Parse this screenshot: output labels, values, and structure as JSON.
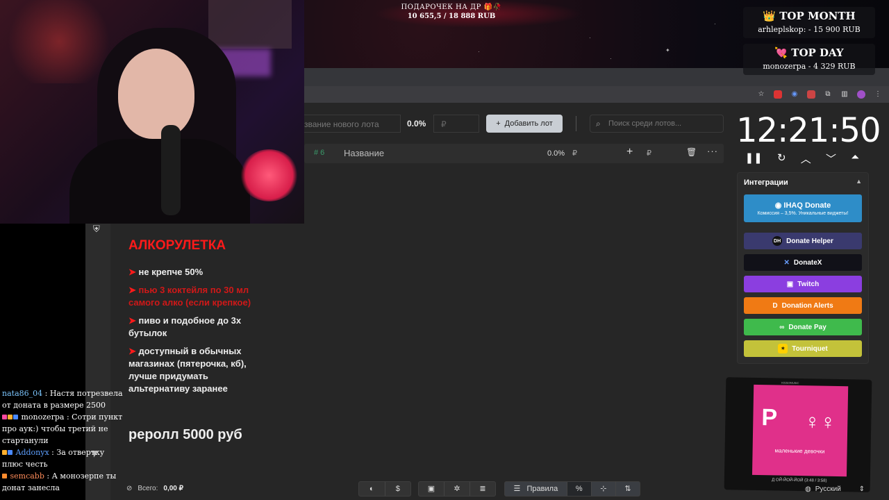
{
  "overlay": {
    "gift_title": "ПОДАРОЧЕК НА ДР 🎁🥀",
    "gift_value": "10 655,5 / 18 888 RUB",
    "top_month": {
      "title": "TOP MONTH",
      "entry": "arhleplskop: - 15 900 RUB",
      "icon": "👑"
    },
    "top_day": {
      "title": "TOP DAY",
      "entry": "monozerpa - 4 329 RUB",
      "icon": "💘"
    }
  },
  "toolbar": {
    "lot_name_placeholder": "Название нового лота",
    "lot_name_visible": "звание нового лота",
    "percent": "0.0%",
    "price_placeholder": "₽",
    "add_button": "Добавить лот",
    "search_placeholder": "Поиск среди лотов..."
  },
  "lots": [
    {
      "number": "# 6",
      "name": "Название",
      "percent": "0.0%",
      "currency": "₽",
      "add_currency": "₽"
    }
  ],
  "timer": {
    "time": "12:21:50"
  },
  "integrations": {
    "title": "Интеграции",
    "ihaq": {
      "label": "IHAQ Donate",
      "sub": "Комиссия – 3,5%. Уникальные виджеты!"
    },
    "buttons": [
      {
        "label": "Donate Helper",
        "color": "#3a3a6e",
        "icon": "DH"
      },
      {
        "label": "DonateX",
        "color": "#111118",
        "icon": "✕"
      },
      {
        "label": "Twitch",
        "color": "#8b3ee0",
        "icon": "▣"
      },
      {
        "label": "Donation Alerts",
        "color": "#f07a14",
        "icon": "D"
      },
      {
        "label": "Donate Pay",
        "color": "#3fba4c",
        "icon": "∞"
      },
      {
        "label": "Tourniquet",
        "color": "#c3c23a",
        "icon": "✶"
      }
    ]
  },
  "rules": {
    "title": "АЛКОРУЛЕТКА",
    "items": [
      {
        "text": "не крепче 50%",
        "red": false
      },
      {
        "text": "пью 3 коктейля по 30 мл самого алко (если крепкое)",
        "red": true
      },
      {
        "text": "пиво и подобное до 3х бутылок",
        "red": false
      },
      {
        "text": "доступный в обычных магазинах (пятерочка, кб), лучше придумать альтернативу заранее",
        "red": false
      }
    ],
    "reroll": "реролл 5000 руб"
  },
  "chat": [
    {
      "user": "nata86_04",
      "sep": ":",
      "text": "Настя потрезвела от доната в размере 2500",
      "color": "#7cc6ff"
    },
    {
      "user": "monozerpa",
      "sep": ":",
      "text": "Сотри пункт про аук:) чтобы третий не стартанули",
      "color": "#ffffff"
    },
    {
      "user": "Addonyx",
      "sep": ":",
      "text": "За отвертку плюс честь",
      "color": "#5ea0ff"
    },
    {
      "user": "semcabb",
      "sep": ":",
      "text": "А монозерпе ты донат занесла",
      "color": "#ff8c5a"
    }
  ],
  "bottom": {
    "total_label": "Всего:",
    "total_value": "0,00 ₽",
    "rules_button": "Правила",
    "percent_symbol": "%"
  },
  "player": {
    "cover_text": "маленькие девочки",
    "caption": "Д ОЙ-ЙОЙ-ЙОЙ (3:48 / 3:58)",
    "label": "KISSOMUSIC"
  },
  "language": {
    "selected": "Русский"
  }
}
